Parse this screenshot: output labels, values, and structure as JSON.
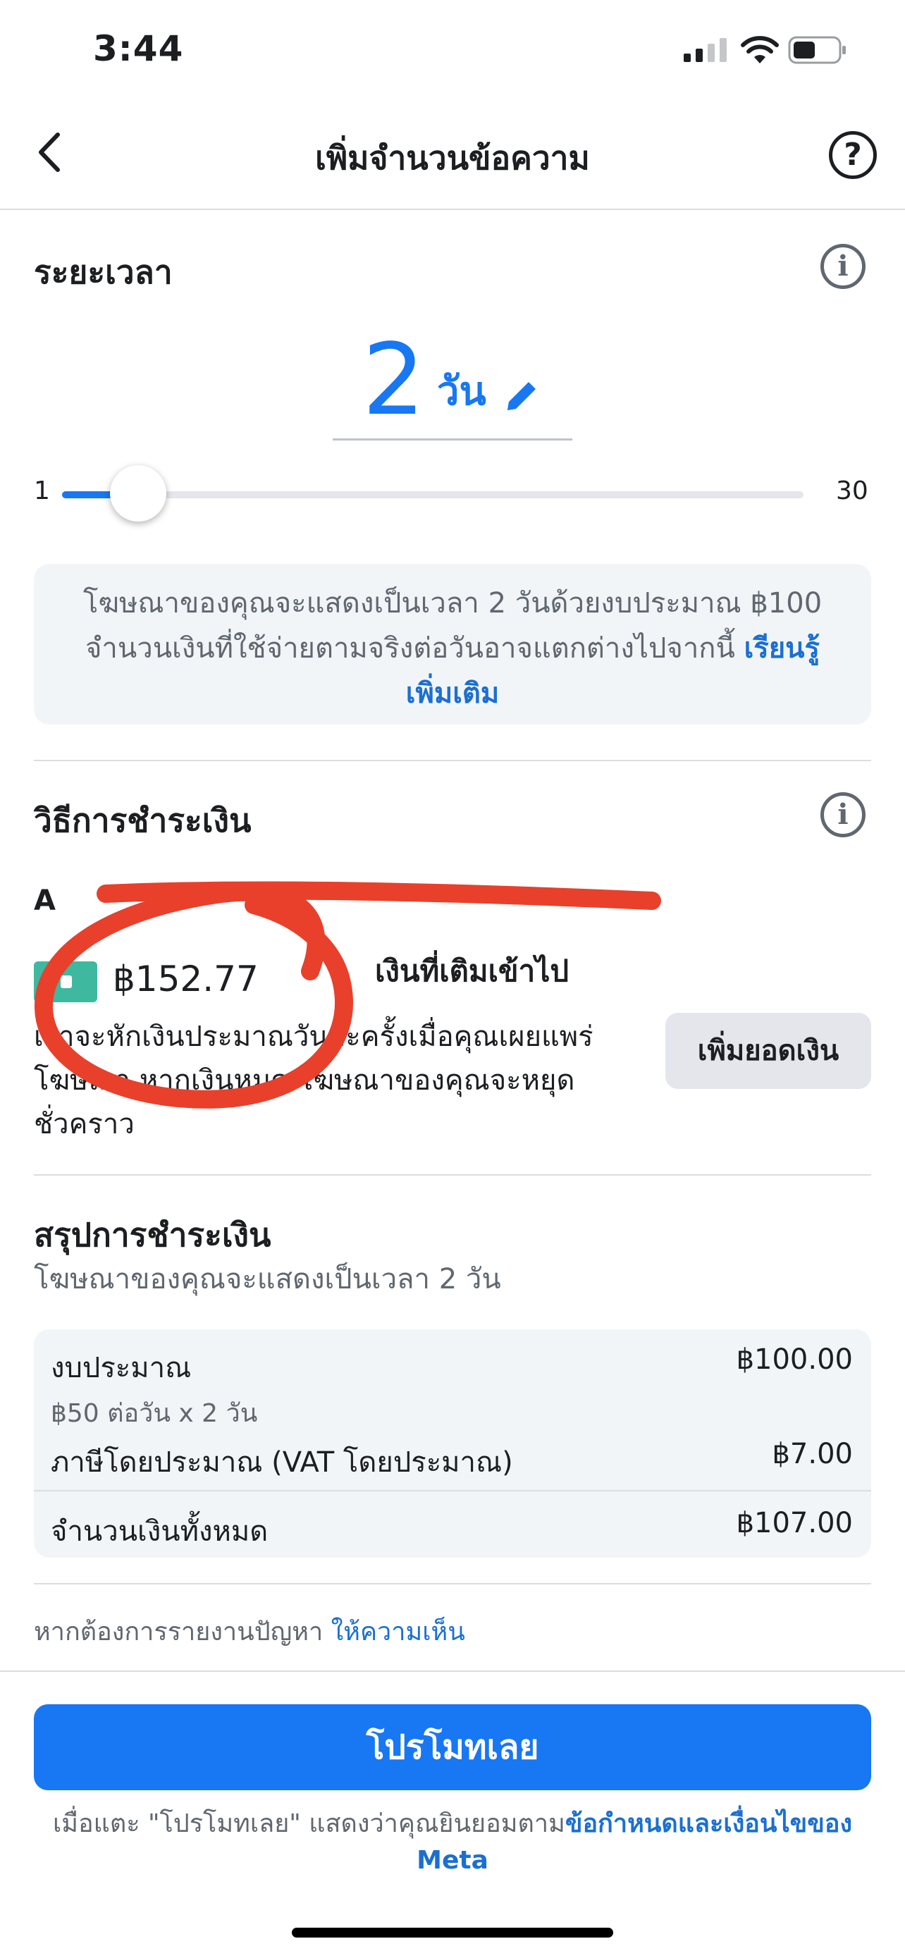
{
  "status_bar": {
    "time": "3:44"
  },
  "nav": {
    "title": "เพิ่มจำนวนข้อความ",
    "help_icon": "?"
  },
  "duration": {
    "title": "ระยะเวลา",
    "value": "2",
    "unit": "วัน",
    "slider_min": "1",
    "slider_max": "30",
    "slider_fraction": 0.034,
    "info_text": "โฆษณาของคุณจะแสดงเป็นเวลา 2 วันด้วยงบประมาณ ฿100 จำนวนเงินที่ใช้จ่ายตามจริงต่อวันอาจแตกต่างไปจากนี้ ",
    "learn_more": "เรียนรู้เพิ่มเติม"
  },
  "payment": {
    "title": "วิธีการชำระเงิน",
    "account_line": "A",
    "balance": "฿152.77",
    "prepaid_label": "เงินที่เติมเข้าไป",
    "description": "เราจะหักเงินประมาณวันละครั้งเมื่อคุณเผยแพร่โฆษณา หากเงินหมด โฆษณาของคุณจะหยุดชั่วคราว",
    "add_funds": "เพิ่มยอดเงิน"
  },
  "summary": {
    "title": "สรุปการชำระเงิน",
    "subtitle": "โฆษณาของคุณจะแสดงเป็นเวลา 2 วัน",
    "budget_label": "งบประมาณ",
    "budget_value": "฿100.00",
    "budget_detail": "฿50 ต่อวัน x 2 วัน",
    "tax_label": "ภาษีโดยประมาณ (VAT โดยประมาณ)",
    "tax_value": "฿7.00",
    "total_label": "จำนวนเงินทั้งหมด",
    "total_value": "฿107.00"
  },
  "report": {
    "text": "หากต้องการรายงานปัญหา ",
    "link": "ให้ความเห็น"
  },
  "footer": {
    "promote_button": "โปรโมทเลย",
    "terms_prefix": "เมื่อแตะ \"โปรโมทเลย\" แสดงว่าคุณยินยอมตาม",
    "terms_link": "ข้อกำหนดและเงื่อนไขของ Meta"
  },
  "colors": {
    "accent": "#1877f2",
    "scribble": "#e8402b",
    "wallet": "#3fb8a0"
  }
}
